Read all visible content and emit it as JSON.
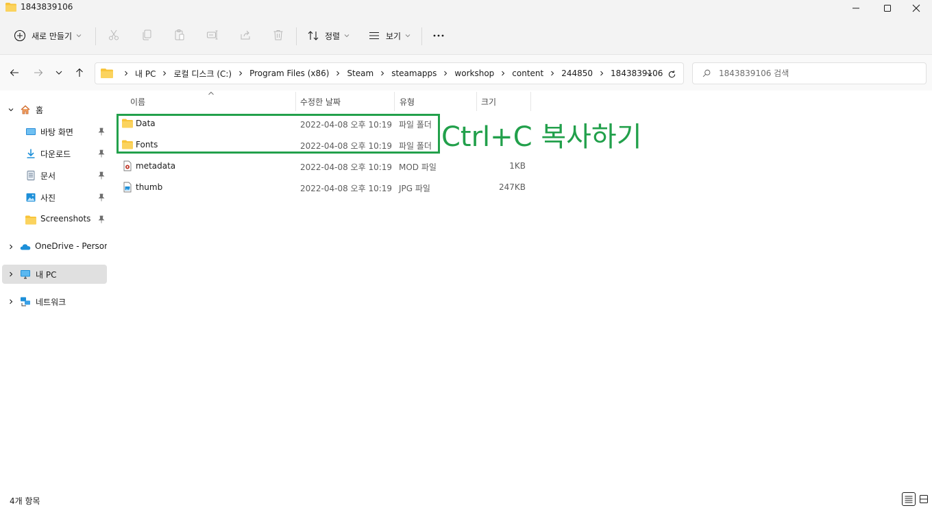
{
  "window": {
    "title": "1843839106"
  },
  "toolbar": {
    "new_label": "새로 만들기",
    "sort_label": "정렬",
    "view_label": "보기"
  },
  "address": {
    "crumbs": [
      "내 PC",
      "로컬 디스크 (C:)",
      "Program Files (x86)",
      "Steam",
      "steamapps",
      "workshop",
      "content",
      "244850",
      "1843839106"
    ]
  },
  "search": {
    "placeholder": "1843839106 검색"
  },
  "sidebar": {
    "items": [
      {
        "label": "홈",
        "icon": "home-icon"
      },
      {
        "label": "바탕 화면",
        "icon": "desktop-icon"
      },
      {
        "label": "다운로드",
        "icon": "download-icon"
      },
      {
        "label": "문서",
        "icon": "document-icon"
      },
      {
        "label": "사진",
        "icon": "pictures-icon"
      },
      {
        "label": "Screenshots",
        "icon": "folder-icon"
      },
      {
        "label": "OneDrive - Persona",
        "icon": "onedrive-icon"
      },
      {
        "label": "내 PC",
        "icon": "pc-icon"
      },
      {
        "label": "네트워크",
        "icon": "network-icon"
      }
    ]
  },
  "columns": {
    "name": "이름",
    "date": "수정한 날짜",
    "type": "유형",
    "size": "크기"
  },
  "files": [
    {
      "name": "Data",
      "date": "2022-04-08 오후 10:19",
      "type": "파일 폴더",
      "size": "",
      "icon": "folder-icon"
    },
    {
      "name": "Fonts",
      "date": "2022-04-08 오후 10:19",
      "type": "파일 폴더",
      "size": "",
      "icon": "folder-icon"
    },
    {
      "name": "metadata",
      "date": "2022-04-08 오후 10:19",
      "type": "MOD 파일",
      "size": "1KB",
      "icon": "mod-file-icon"
    },
    {
      "name": "thumb",
      "date": "2022-04-08 오후 10:19",
      "type": "JPG 파일",
      "size": "247KB",
      "icon": "image-file-icon"
    }
  ],
  "annotation": {
    "text": "Ctrl+C 복사하기",
    "color": "#22a04b"
  },
  "status": {
    "item_count": "4개 항목"
  },
  "colors": {
    "accent": "#0067c0",
    "folder": "#f8c43a",
    "selection": "#e0e0e0"
  }
}
